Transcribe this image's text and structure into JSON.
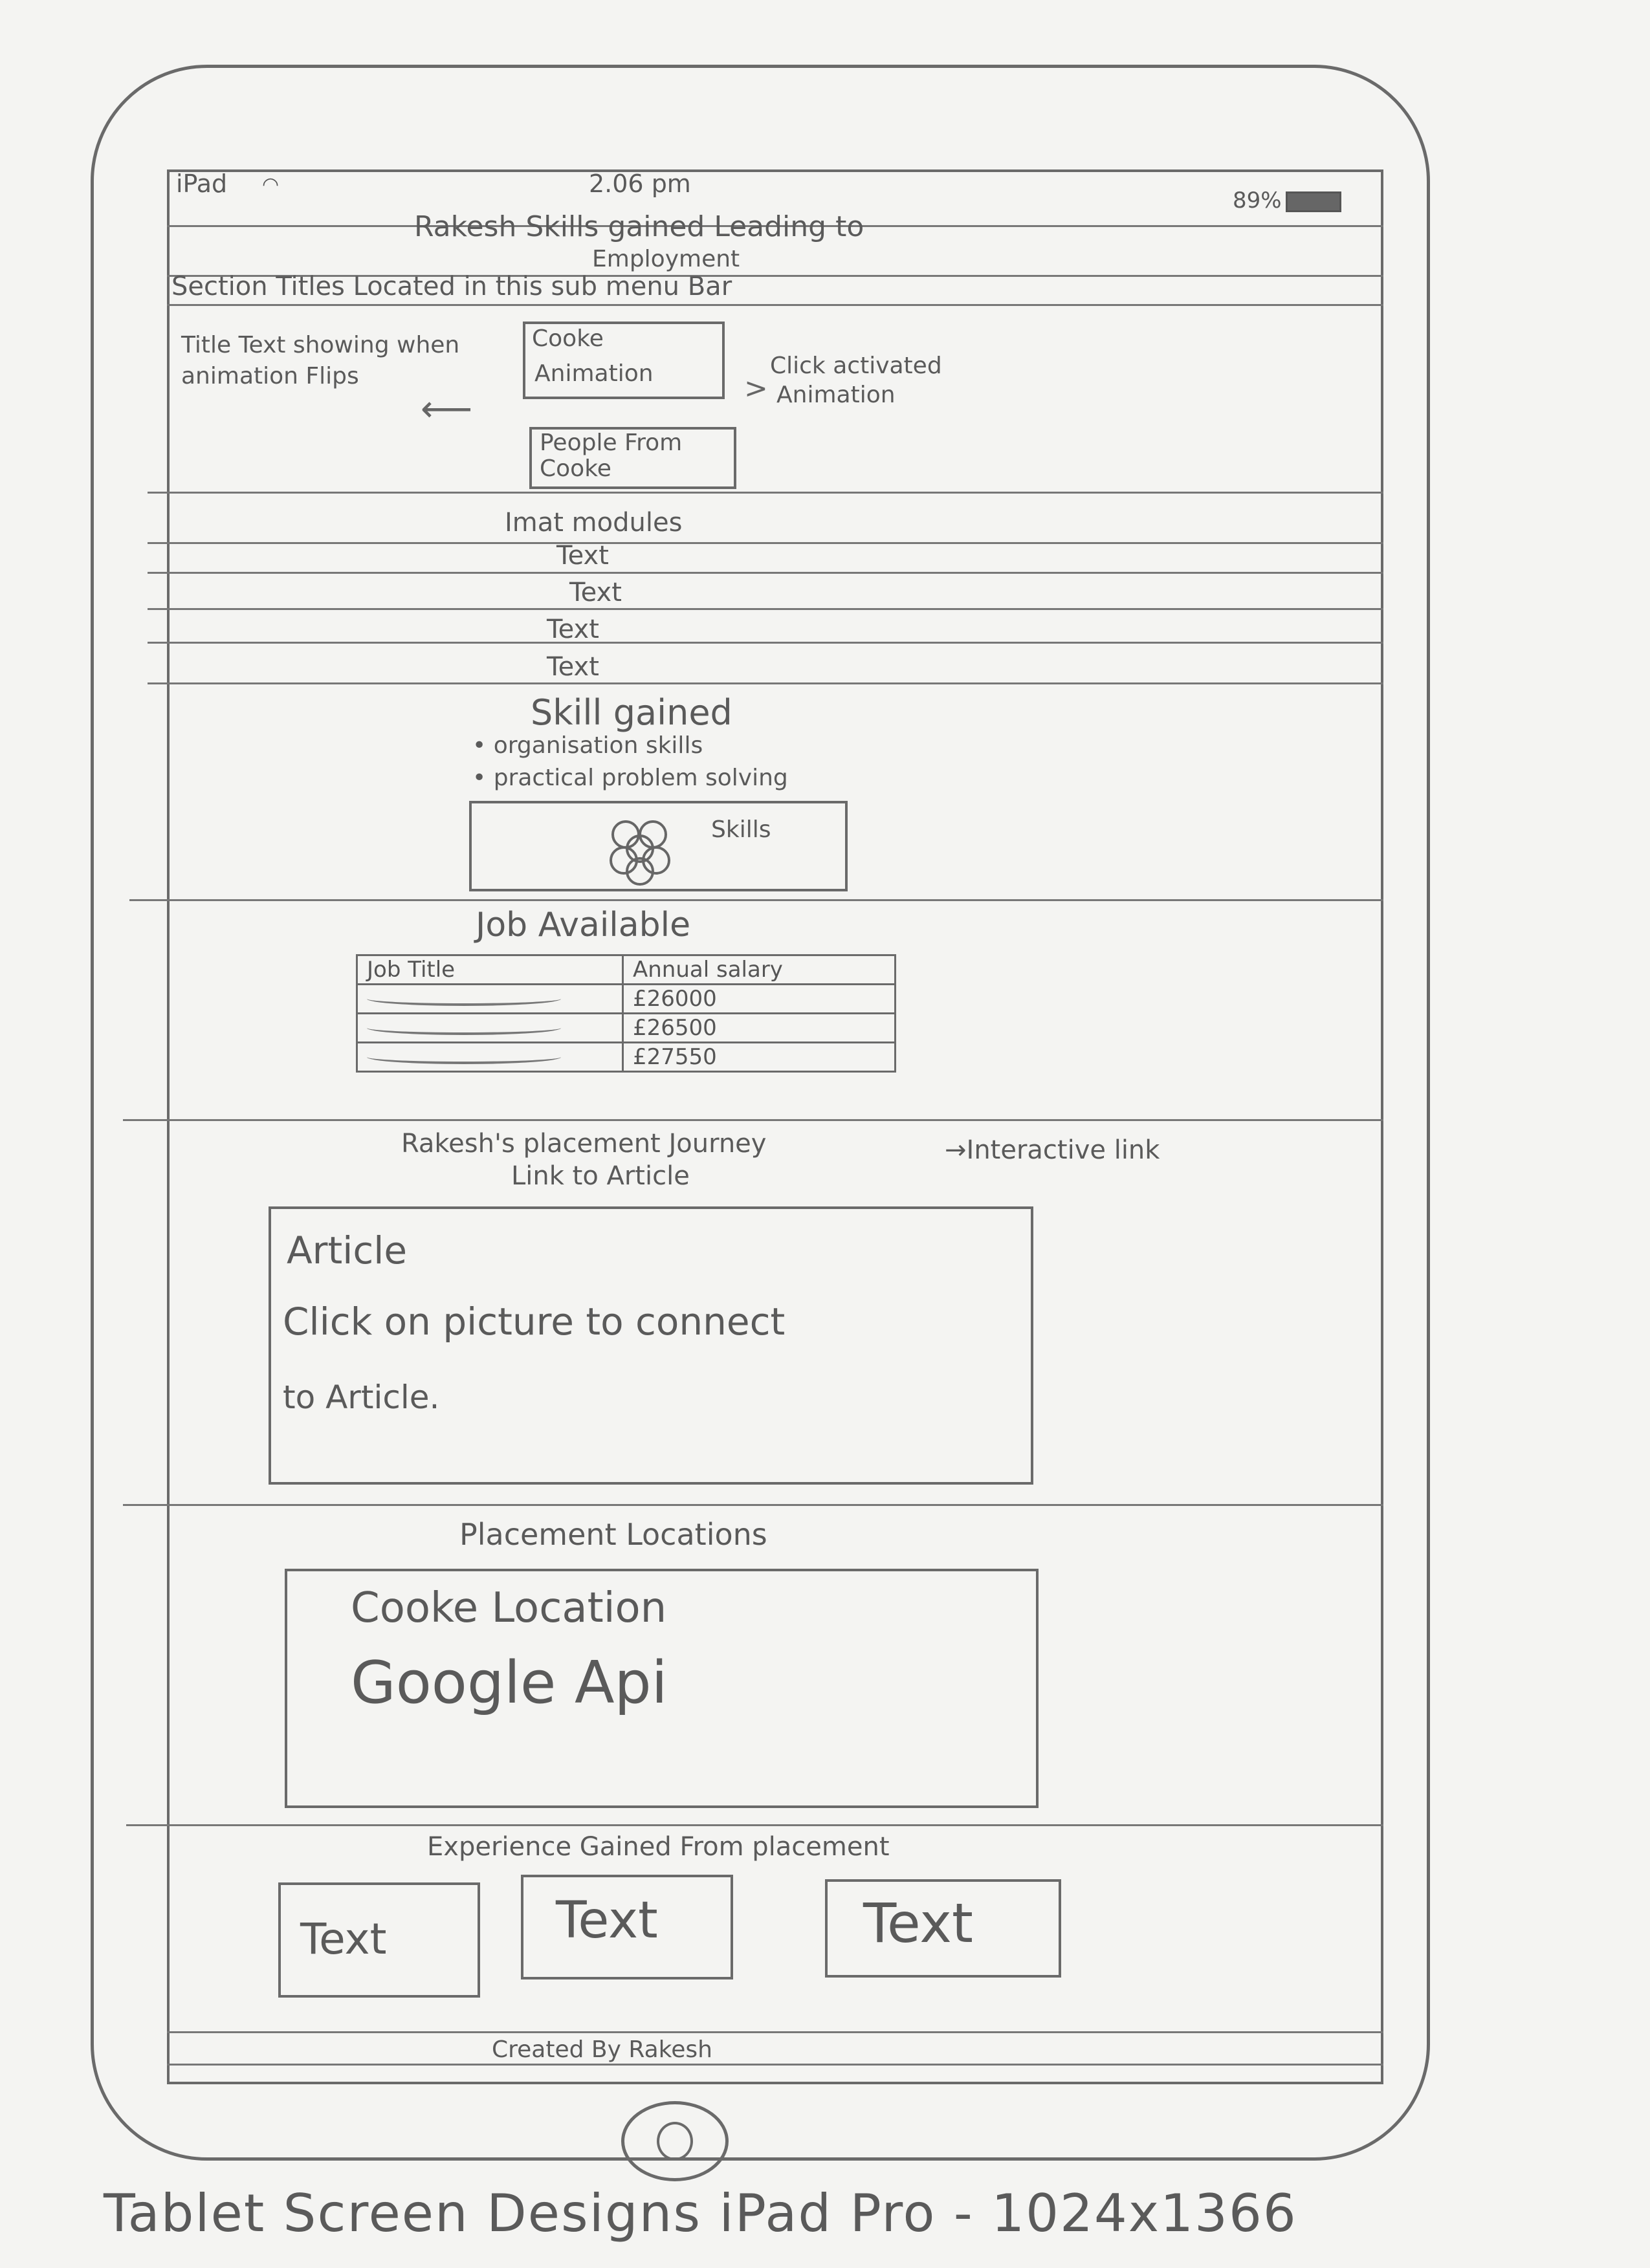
{
  "status_bar": {
    "device": "iPad",
    "time": "2.06 pm",
    "battery": "89%"
  },
  "header": {
    "title_line1": "Rakesh Skills gained Leading to",
    "title_line2": "Employment",
    "submenu": "Section Titles Located in this sub menu Bar"
  },
  "animation_section": {
    "note_title": "Title Text showing when animation Flips",
    "box1_line1": "Cooke",
    "box1_line2": "Animation",
    "box2_line1": "People From",
    "box2_line2": "Cooke",
    "note_click_line1": "Click activated",
    "note_click_line2": "Animation"
  },
  "modules": {
    "heading": "Imat modules",
    "rows": [
      "Text",
      "Text",
      "Text",
      "Text"
    ]
  },
  "skills": {
    "heading": "Skill gained",
    "bullets": [
      "organisation skills",
      "practical problem solving"
    ],
    "box_label": "Skills"
  },
  "jobs": {
    "heading": "Job Available",
    "columns": [
      "Job Title",
      "Annual salary"
    ],
    "salaries": [
      "£26000",
      "£26500",
      "£27550"
    ]
  },
  "journey": {
    "heading_line1": "Rakesh's placement Journey",
    "heading_line2": "Link to Article",
    "note": "Interactive link",
    "article_title": "Article",
    "article_line1": "Click on picture to connect",
    "article_line2": "to Article."
  },
  "location": {
    "heading": "Placement Locations",
    "line1": "Cooke Location",
    "line2": "Google Api"
  },
  "experience": {
    "heading": "Experience Gained From placement",
    "boxes": [
      "Text",
      "Text",
      "Text"
    ]
  },
  "footer": {
    "text": "Created By Rakesh"
  },
  "caption": "Tablet Screen Designs iPad Pro - 1024x1366"
}
